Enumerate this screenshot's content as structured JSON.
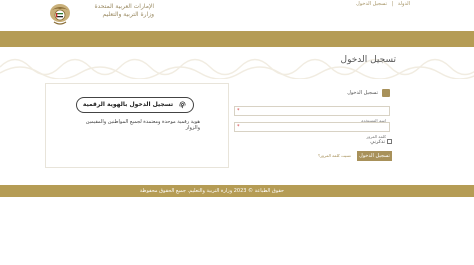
{
  "header": {
    "ministry_line1": "الإمارات العربية المتحدة",
    "ministry_line2": "وزارة التربية والتعليم",
    "nav": [
      "الدولة",
      "تسجيل الدخول"
    ],
    "nav_separator": "|"
  },
  "page": {
    "title": "تسجيل الدخول"
  },
  "uaepass": {
    "button_label": "تسجيل الدخول بالهوية الرقمية",
    "description": "هوية رقمية موحدة ومعتمدة لجميع المواطنين والمقيمين والزوار"
  },
  "login_form": {
    "heading": "تسجيل الدخول",
    "username_placeholder": "اسم المستخدم",
    "password_placeholder": "كلمة المرور",
    "required_mark": "*",
    "remember_label": "تذكرني",
    "submit_label": "تسجيل الدخول",
    "forgot_label": "نسيت كلمة المرور؟"
  },
  "footer": {
    "text": "حقوق الطباعة © 2023 وزارة التربية والتعليم. جميع الحقوق محفوظة"
  },
  "colors": {
    "gold": "#b59c55",
    "button_gold": "#a8915a",
    "required_red": "#d23b3b"
  }
}
